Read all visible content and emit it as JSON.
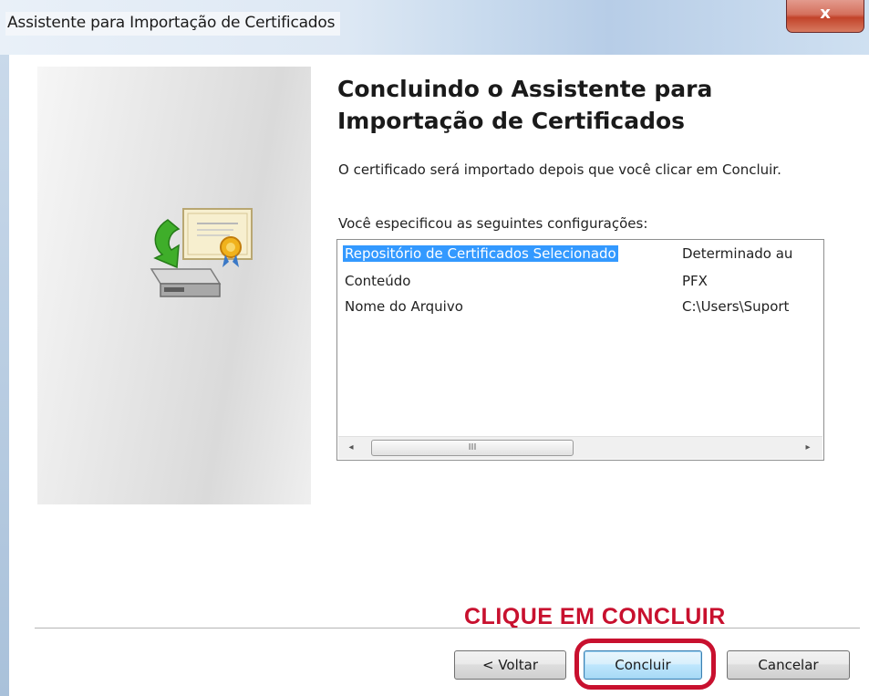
{
  "window": {
    "title": "Assistente para Importação de Certificados",
    "close_symbol": "x",
    "close_color": "#c2432a"
  },
  "wizard": {
    "heading_line1": "Concluindo o Assistente para",
    "heading_line2": "Importação de Certificados",
    "intro": "O certificado será importado depois que você clicar em Concluir.",
    "settings_label": "Você especificou as seguintes configurações:",
    "settings": [
      {
        "name": "Repositório de Certificados Selecionado",
        "value": "Determinado au",
        "selected": true
      },
      {
        "name": "Conteúdo",
        "value": "PFX",
        "selected": false
      },
      {
        "name": "Nome do Arquivo",
        "value": "C:\\Users\\Suport",
        "selected": false
      }
    ],
    "scrollbar": {
      "left_arrow": "◂",
      "right_arrow": "▸",
      "thumb_grip": "III"
    },
    "banner_icon": "certificate-import-icon"
  },
  "annotation": {
    "text": "CLIQUE EM CONCLUIR",
    "color": "#c8102e"
  },
  "buttons": {
    "back": "< Voltar",
    "finish": "Concluir",
    "cancel": "Cancelar"
  },
  "colors": {
    "selection": "#3399ff",
    "accent_button": "#3c7fb1"
  }
}
